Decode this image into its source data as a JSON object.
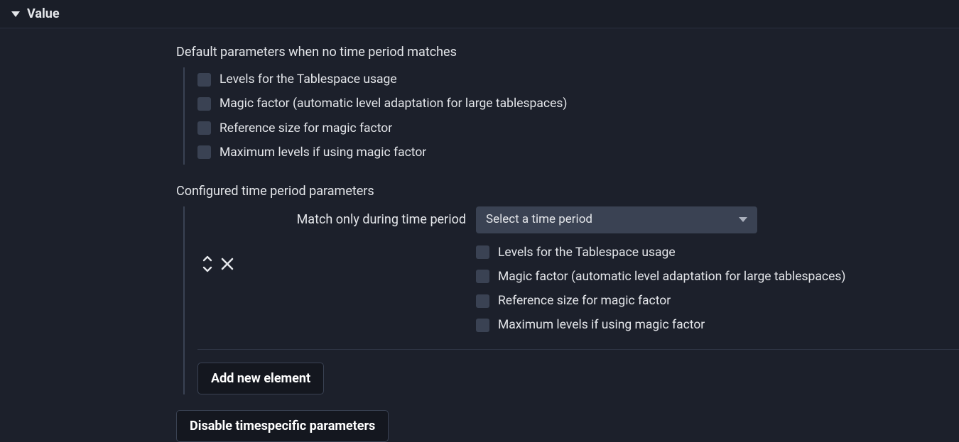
{
  "section": {
    "title": "Value"
  },
  "default": {
    "heading": "Default parameters when no time period matches",
    "options": [
      {
        "label": "Levels for the Tablespace usage"
      },
      {
        "label": "Magic factor (automatic level adaptation for large tablespaces)"
      },
      {
        "label": "Reference size for magic factor"
      },
      {
        "label": "Maximum levels if using magic factor"
      }
    ]
  },
  "configured": {
    "heading": "Configured time period parameters",
    "match_label": "Match only during time period",
    "select_placeholder": "Select a time period",
    "options": [
      {
        "label": "Levels for the Tablespace usage"
      },
      {
        "label": "Magic factor (automatic level adaptation for large tablespaces)"
      },
      {
        "label": "Reference size for magic factor"
      },
      {
        "label": "Maximum levels if using magic factor"
      }
    ],
    "add_button": "Add new element"
  },
  "disable_button": "Disable timespecific parameters"
}
